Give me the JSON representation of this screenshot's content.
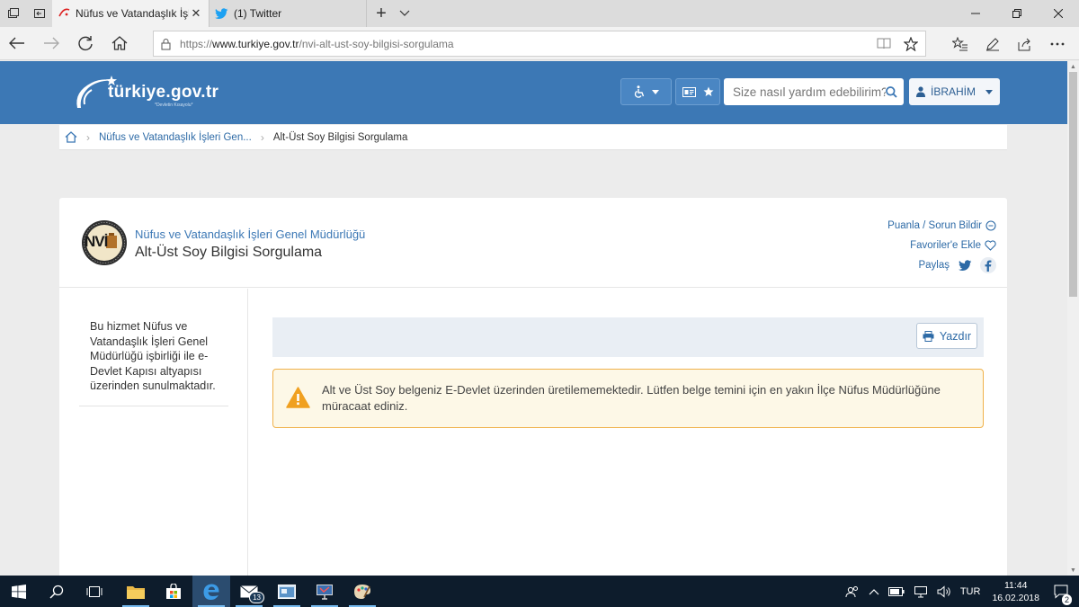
{
  "browser": {
    "tabs": [
      {
        "title": "Nüfus ve Vatandaşlık İşl",
        "active": true
      },
      {
        "title": "(1) Twitter",
        "active": false
      }
    ],
    "address": {
      "prefix": "https://",
      "domain": "www.turkiye.gov.tr",
      "path": "/nvi-alt-ust-soy-bilgisi-sorgulama"
    }
  },
  "header": {
    "logo_text": "türkiye.gov.tr",
    "logo_sub": "*Devletin Kısayolu*",
    "search_placeholder": "Size nasıl yardım edebilirim?",
    "user_name": "İBRAHİM"
  },
  "breadcrumb": {
    "items": [
      "Nüfus ve Vatandaşlık İşleri Gen...",
      "Alt-Üst Soy Bilgisi Sorgulama"
    ]
  },
  "service": {
    "agency": "Nüfus ve Vatandaşlık İşleri Genel Müdürlüğü",
    "title": "Alt-Üst Soy Bilgisi Sorgulama",
    "logo_text": "NVİ",
    "actions": {
      "rate": "Puanla / Sorun Bildir",
      "favorite": "Favoriler'e Ekle",
      "share": "Paylaş"
    }
  },
  "sidebar": {
    "note": "Bu hizmet Nüfus ve Vatandaşlık İşleri Genel Müdürlüğü işbirliği ile e-Devlet Kapısı altyapısı üzerinden sunulmaktadır."
  },
  "content": {
    "print_label": "Yazdır",
    "alert_text": "Alt ve Üst Soy belgeniz E-Devlet üzerinden üretilememektedir. Lütfen belge temini için en yakın İlçe Nüfus Müdürlüğüne müracaat ediniz."
  },
  "taskbar": {
    "mail_badge": "13",
    "language": "TUR",
    "time": "11:44",
    "date": "16.02.2018",
    "notification_count": "2"
  },
  "colors": {
    "brand_blue": "#3c78b5",
    "alert_border": "#f0b14a",
    "alert_icon": "#f0a020",
    "taskbar": "#0d1c2c"
  }
}
